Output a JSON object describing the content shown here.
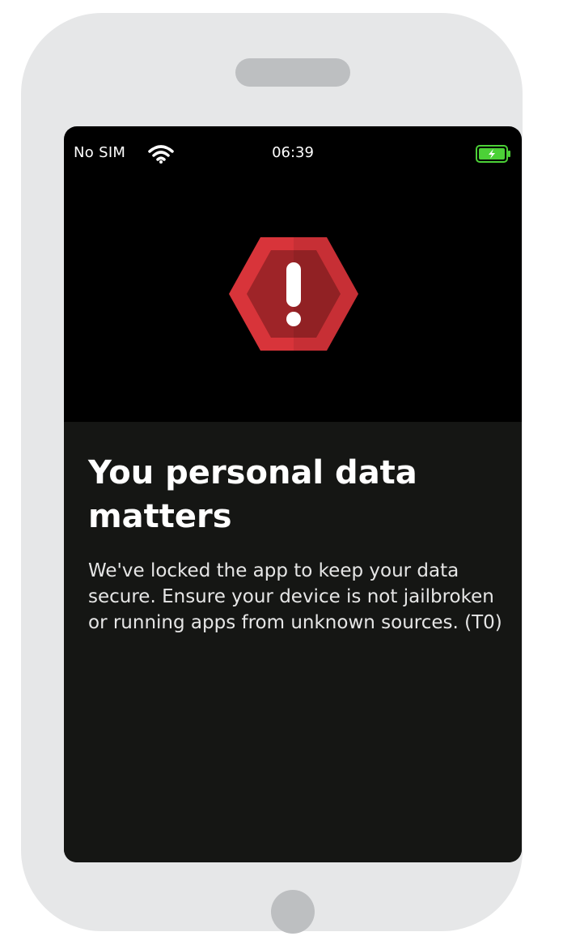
{
  "status_bar": {
    "carrier": "No SIM",
    "time": "06:39",
    "wifi_icon": "wifi-icon",
    "battery_icon": "battery-charging-icon"
  },
  "alert": {
    "icon": "warning-hexagon-icon",
    "title": "You personal data matters",
    "message": "We've locked the app to keep your data secure. Ensure your device is not jailbroken or running apps from unknown sources. (T0)"
  },
  "colors": {
    "phone_frame": "#e6e7e8",
    "screen_background": "#000000",
    "content_background": "#151614",
    "warning_red": "#d8343a",
    "warning_dark_red": "#9e2428",
    "battery_green": "#4cd137"
  }
}
